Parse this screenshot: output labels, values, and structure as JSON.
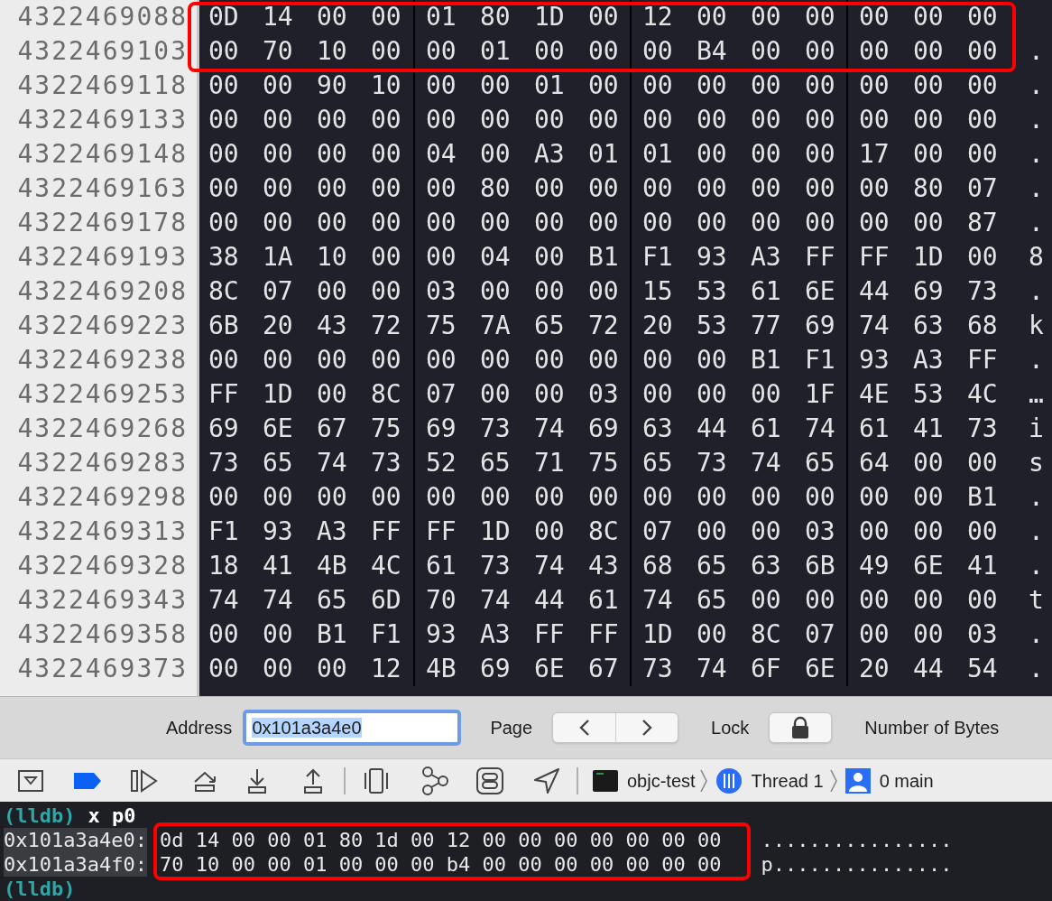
{
  "memory_view": {
    "rows": [
      {
        "address": "4322469088",
        "bytes": "0D 14 00 00 01 80 1D 00 12 00 00 00 00 00 00",
        "highlighted": true
      },
      {
        "address": "4322469103",
        "bytes": "00 70 10 00 00 01 00 00 00 B4 00 00 00 00 00",
        "ascii": ".",
        "highlighted": true
      },
      {
        "address": "4322469118",
        "bytes": "00 00 90 10 00 00 01 00 00 00 00 00 00 00 00",
        "ascii": ".",
        "highlighted": false
      },
      {
        "address": "4322469133",
        "bytes": "00 00 00 00 00 00 00 00 00 00 00 00 00 00 00",
        "ascii": ".",
        "highlighted": false
      },
      {
        "address": "4322469148",
        "bytes": "00 00 00 00 04 00 A3 01 01 00 00 00 17 00 00",
        "ascii": ".",
        "highlighted": false
      },
      {
        "address": "4322469163",
        "bytes": "00 00 00 00 00 80 00 00 00 00 00 00 00 80 07",
        "ascii": ".",
        "highlighted": false
      },
      {
        "address": "4322469178",
        "bytes": "00 00 00 00 00 00 00 00 00 00 00 00 00 00 87",
        "ascii": ".",
        "highlighted": false
      },
      {
        "address": "4322469193",
        "bytes": "38 1A 10 00 00 04 00 B1 F1 93 A3 FF FF 1D 00",
        "ascii": "8",
        "highlighted": false
      },
      {
        "address": "4322469208",
        "bytes": "8C 07 00 00 03 00 00 00 15 53 61 6E 44 69 73",
        "ascii": ".",
        "highlighted": false
      },
      {
        "address": "4322469223",
        "bytes": "6B 20 43 72 75 7A 65 72 20 53 77 69 74 63 68",
        "ascii": "k",
        "highlighted": false
      },
      {
        "address": "4322469238",
        "bytes": "00 00 00 00 00 00 00 00 00 00 B1 F1 93 A3 FF",
        "ascii": ".",
        "highlighted": false
      },
      {
        "address": "4322469253",
        "bytes": "FF 1D 00 8C 07 00 00 03 00 00 00 1F 4E 53 4C",
        "ascii": "…",
        "highlighted": false
      },
      {
        "address": "4322469268",
        "bytes": "69 6E 67 75 69 73 74 69 63 44 61 74 61 41 73",
        "ascii": "i",
        "highlighted": false
      },
      {
        "address": "4322469283",
        "bytes": "73 65 74 73 52 65 71 75 65 73 74 65 64 00 00",
        "ascii": "s",
        "highlighted": false
      },
      {
        "address": "4322469298",
        "bytes": "00 00 00 00 00 00 00 00 00 00 00 00 00 00 B1",
        "ascii": ".",
        "highlighted": false
      },
      {
        "address": "4322469313",
        "bytes": "F1 93 A3 FF FF 1D 00 8C 07 00 00 03 00 00 00",
        "ascii": ".",
        "highlighted": false
      },
      {
        "address": "4322469328",
        "bytes": "18 41 4B 4C 61 73 74 43 68 65 63 6B 49 6E 41",
        "ascii": ".",
        "highlighted": false
      },
      {
        "address": "4322469343",
        "bytes": "74 74 65 6D 70 74 44 61 74 65 00 00 00 00 00",
        "ascii": "t",
        "highlighted": false
      },
      {
        "address": "4322469358",
        "bytes": "00 00 B1 F1 93 A3 FF FF 1D 00 8C 07 00 00 03",
        "ascii": ".",
        "highlighted": false
      },
      {
        "address": "4322469373",
        "bytes": "00 00 00 12 4B 69 6E 67 73 74 6F 6E 20 44 54",
        "ascii": ".",
        "highlighted": false
      }
    ]
  },
  "address_bar": {
    "address_label": "Address",
    "address_value": "0x101a3a4e0",
    "value_selected": true,
    "page_label": "Page",
    "lock_label": "Lock",
    "bytes_label": "Number of Bytes"
  },
  "debug_bar": {
    "process": "objc-test",
    "thread": "Thread 1",
    "frame": "0 main"
  },
  "console": {
    "lines": [
      {
        "kind": "prompt",
        "prompt": "(lldb)",
        "command": "x p0"
      },
      {
        "kind": "output",
        "address": "0x101a3a4e0:",
        "bytes": "0d 14 00 00 01 80 1d 00 12 00 00 00 00 00 00 00",
        "ascii": "................",
        "highlighted": true
      },
      {
        "kind": "output",
        "address": "0x101a3a4f0:",
        "bytes": "70 10 00 00 01 00 00 00 b4 00 00 00 00 00 00 00",
        "ascii": "p...............",
        "highlighted": true
      },
      {
        "kind": "prompt",
        "prompt": "(lldb)"
      }
    ]
  }
}
